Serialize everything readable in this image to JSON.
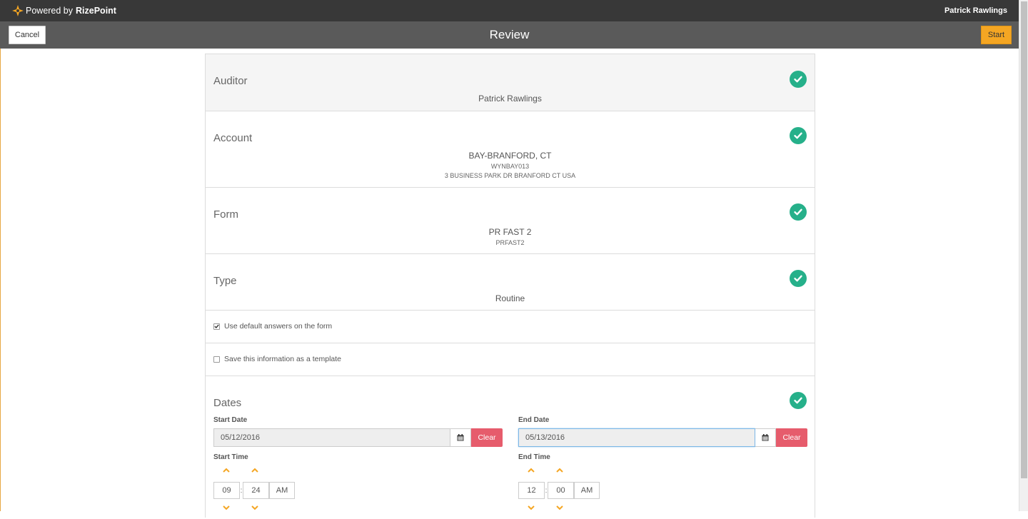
{
  "topbar": {
    "brand_prefix": "Powered by",
    "brand_name": "RizePoint",
    "user_name": "Patrick Rawlings"
  },
  "header": {
    "title": "Review",
    "cancel_label": "Cancel",
    "start_label": "Start"
  },
  "sections": {
    "auditor": {
      "label": "Auditor",
      "value": "Patrick Rawlings"
    },
    "account": {
      "label": "Account",
      "value": "BAY-BRANFORD, CT",
      "code": "WYNBAY013",
      "address": "3 BUSINESS PARK DR BRANFORD CT USA"
    },
    "form": {
      "label": "Form",
      "value": "PR FAST 2",
      "code": "PRFAST2"
    },
    "type": {
      "label": "Type",
      "value": "Routine"
    },
    "default_answers": {
      "label": "Use default answers on the form",
      "checked": true
    },
    "save_template": {
      "label": "Save this information as a template",
      "checked": false
    },
    "dates": {
      "label": "Dates",
      "start_date_label": "Start Date",
      "start_date": "05/12/2016",
      "end_date_label": "End Date",
      "end_date": "05/13/2016",
      "clear_label": "Clear",
      "start_time_label": "Start Time",
      "start_hour": "09",
      "start_minute": "24",
      "start_ampm": "AM",
      "end_time_label": "End Time",
      "end_hour": "12",
      "end_minute": "00",
      "end_ampm": "AM",
      "time_separator": ":"
    }
  },
  "colors": {
    "accent_orange": "#f5a623",
    "check_green": "#26b08a",
    "clear_red": "#e65c6c"
  }
}
